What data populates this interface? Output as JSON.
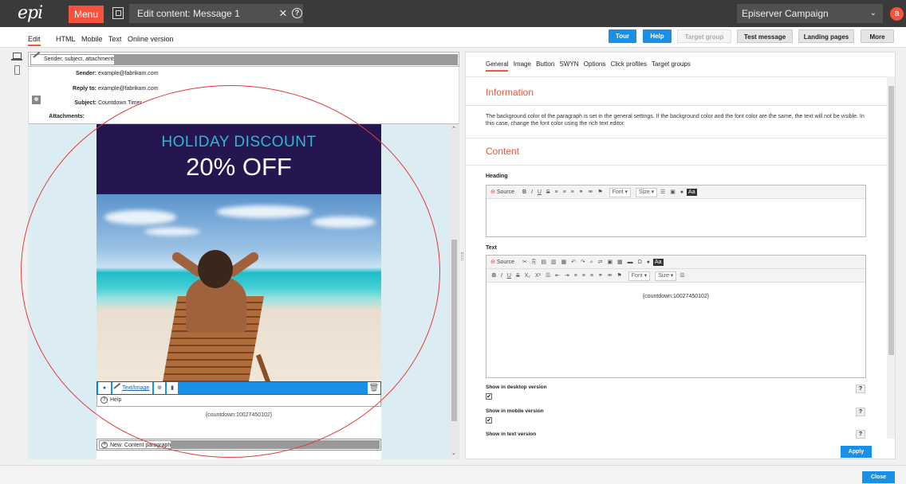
{
  "topbar": {
    "logo": "epi",
    "menu_label": "Menu",
    "title": "Edit content: Message 1",
    "close_glyph": "×",
    "help_glyph": "?",
    "product": "Episerver Campaign",
    "avatar_letter": "a",
    "accent_color": "#f5533d"
  },
  "toolbar": {
    "view_tabs": [
      "Edit",
      "HTML",
      "Mobile",
      "Text",
      "Online version"
    ],
    "active_tab": "Edit",
    "buttons": {
      "tour": "Tour",
      "help": "Help",
      "target_group": "Target group",
      "test_message": "Test message",
      "landing_pages": "Landing pages",
      "more": "More"
    }
  },
  "left": {
    "header_tab": "Sender, subject, attachments",
    "fields": {
      "sender_label": "Sender:",
      "sender_value": "example@fabrikam.com",
      "reply_label": "Reply to:",
      "reply_value": "example@fabrikam.com",
      "subject_label": "Subject:",
      "subject_value": "Countdown Timer",
      "attachments_label": "Attachments:"
    },
    "email": {
      "banner_heading": "HOLIDAY DISCOUNT",
      "banner_offer": "20% OFF",
      "paragraph_tab": "Text/Image",
      "help_label": "Help",
      "countdown": "{countdown:10027450102}",
      "new_paragraph": "New: Content paragraph"
    }
  },
  "right": {
    "tabs": [
      "General",
      "Image",
      "Button",
      "SWYN",
      "Options",
      "Click profiles",
      "Target groups"
    ],
    "active_tab": "General",
    "info_title": "Information",
    "info_text": "The background color of the paragraph is set in the general settings. If the background color and the font color are the same, the text will not be visible. In this case, change the font color using the rich text editor.",
    "content_title": "Content",
    "heading_label": "Heading",
    "text_label": "Text",
    "editor": {
      "source": "Source",
      "font": "Font",
      "size": "Size",
      "body": "{countdown:10027450102}"
    },
    "options": [
      {
        "label": "Show in desktop version",
        "checked": "✔"
      },
      {
        "label": "Show in mobile version",
        "checked": "✔"
      },
      {
        "label": "Show in text version",
        "checked": ""
      }
    ],
    "q_glyph": "?",
    "apply": "Apply"
  },
  "footer": {
    "close": "Close"
  }
}
